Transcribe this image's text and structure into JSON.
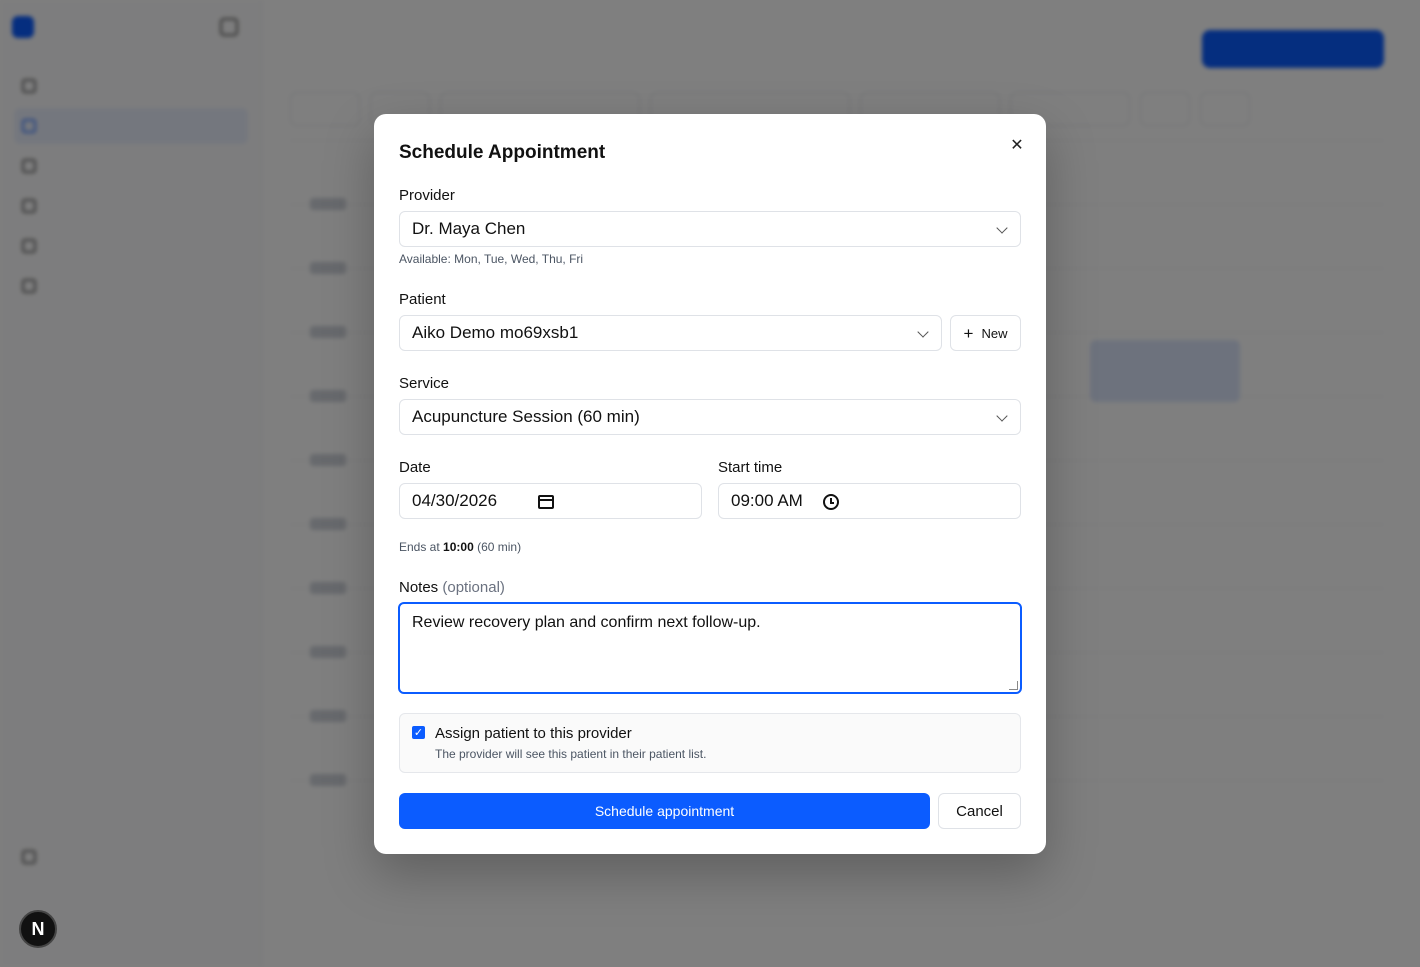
{
  "modal": {
    "title": "Schedule Appointment",
    "provider": {
      "label": "Provider",
      "value": "Dr. Maya Chen",
      "availability": "Available: Mon, Tue, Wed, Thu, Fri"
    },
    "patient": {
      "label": "Patient",
      "value": "Aiko Demo mo69xsb1",
      "new_label": "New"
    },
    "service": {
      "label": "Service",
      "value": "Acupuncture Session (60 min)"
    },
    "date": {
      "label": "Date",
      "value": "04/30/2026"
    },
    "start_time": {
      "label": "Start time",
      "value": "09:00 AM"
    },
    "ends": {
      "prefix": "Ends at",
      "time": "10:00",
      "duration": "(60 min)"
    },
    "notes": {
      "label": "Notes",
      "optional": "(optional)",
      "value": "Review recovery plan and confirm next follow-up."
    },
    "assign": {
      "checked": true,
      "title": "Assign patient to this provider",
      "description": "The provider will see this patient in their patient list."
    },
    "submit_label": "Schedule appointment",
    "cancel_label": "Cancel"
  },
  "floating_avatar": "N",
  "colors": {
    "accent": "#0b5cff",
    "overlay": "rgba(0,0,0,0.5)"
  },
  "icons": [
    "close-icon",
    "chevron-down-icon",
    "plus-icon",
    "calendar-icon",
    "clock-icon",
    "checkbox-checked-icon"
  ]
}
